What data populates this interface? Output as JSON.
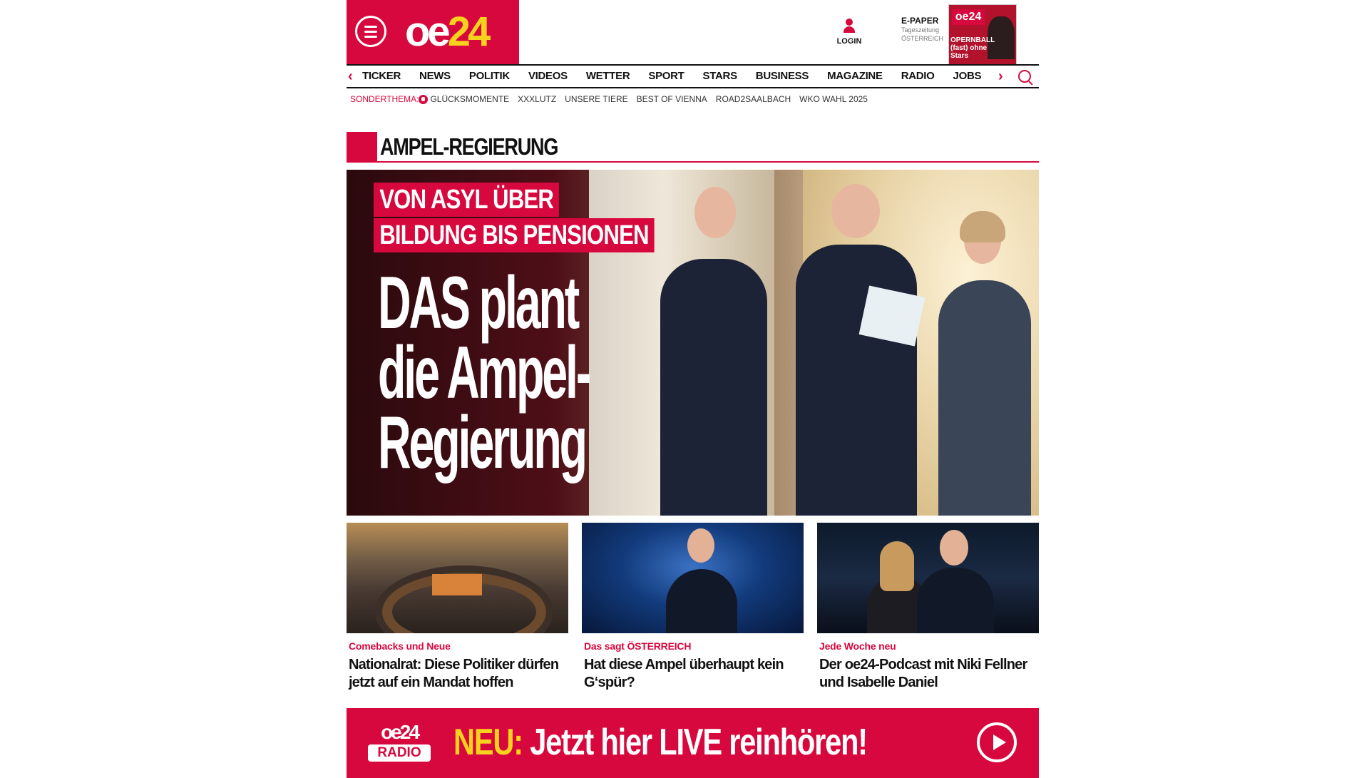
{
  "brand": {
    "logo_main": "oe",
    "logo_num": "24",
    "accent": "#d7083d",
    "yellow": "#f6d21e"
  },
  "header": {
    "login_label": "LOGIN",
    "epaper_title": "E-PAPER",
    "epaper_sub1": "Tageszeitung",
    "epaper_sub2": "ÖSTERREICH",
    "epaper_headline": "OPERNBALL (fast) ohne Stars"
  },
  "nav": {
    "items": [
      "TICKER",
      "NEWS",
      "POLITIK",
      "VIDEOS",
      "WETTER",
      "SPORT",
      "STARS",
      "BUSINESS",
      "MAGAZINE",
      "RADIO",
      "JOBS"
    ]
  },
  "subnav": {
    "lead": "SONDERTHEMA:",
    "items": [
      "GLÜCKSMOMENTE",
      "XXXLUTZ",
      "UNSERE TIERE",
      "BEST OF VIENNA",
      "ROAD2SAALBACH",
      "WKO WAHL 2025"
    ]
  },
  "section": {
    "title": "AMPEL-REGIERUNG"
  },
  "hero": {
    "kicker_line1": "VON ASYL ÜBER",
    "kicker_line2": "BILDUNG BIS PENSIONEN",
    "headline_line1": "DAS plant",
    "headline_line2": "die Ampel-",
    "headline_line3": "Regierung"
  },
  "cards": [
    {
      "kicker": "Comebacks und Neue",
      "title": "Nationalrat: Diese Politiker dürfen jetzt auf ein Mandat hoffen"
    },
    {
      "kicker": "Das sagt ÖSTERREICH",
      "title": "Hat diese Ampel überhaupt kein G‘spür?"
    },
    {
      "kicker": "Jede Woche neu",
      "title": "Der oe24-Podcast mit Niki Fellner und Isabelle Daniel"
    }
  ],
  "radio": {
    "logo_top": "oe24",
    "logo_bottom": "RADIO",
    "neu": "NEU:",
    "text": " Jetzt hier LIVE reinhören!"
  }
}
